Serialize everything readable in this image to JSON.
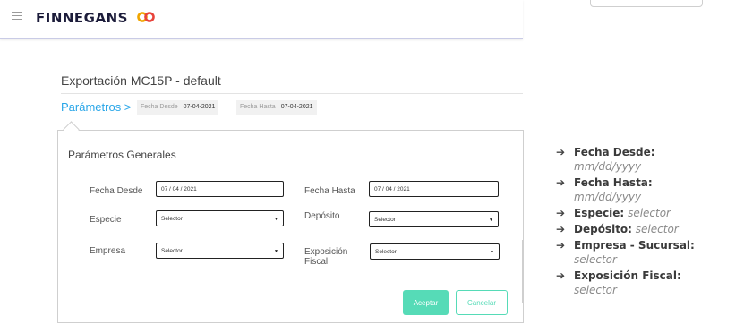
{
  "app": {
    "brand": "FINNEGANS"
  },
  "page": {
    "title": "Exportación MC15P - default",
    "breadcrumb": "Parámetros >",
    "chips": [
      {
        "key": "Fecha Desde",
        "value": "07-04-2021"
      },
      {
        "key": "Fecha Hasta",
        "value": "07-04-2021"
      }
    ]
  },
  "panel": {
    "title": "Parámetros Generales",
    "fields": {
      "fecha_desde": {
        "label": "Fecha Desde",
        "value": "07 / 04 / 2021"
      },
      "fecha_hasta": {
        "label": "Fecha Hasta",
        "value": "07 / 04 / 2021"
      },
      "especie": {
        "label": "Especie",
        "value": "Selector"
      },
      "deposito": {
        "label": "Depósito",
        "value": "Selector"
      },
      "empresa": {
        "label": "Empresa",
        "value": "Selector"
      },
      "exposicion": {
        "label_line1": "Exposición",
        "label_line2": "Fiscal",
        "value": "Selector"
      }
    },
    "buttons": {
      "accept": "Aceptar",
      "cancel": "Cancelar"
    }
  },
  "notes": [
    {
      "label": "Fecha Desde:",
      "detail": "mm/dd/yyyy"
    },
    {
      "label": "Fecha Hasta:",
      "detail": "mm/dd/yyyy"
    },
    {
      "label": "Especie:",
      "detail": "selector"
    },
    {
      "label": "Depósito:",
      "detail": "selector"
    },
    {
      "label": "Empresa - Sucursal:",
      "detail": "selector"
    },
    {
      "label": "Exposición Fiscal:",
      "detail": "selector"
    }
  ],
  "colors": {
    "accent": "#29a6e8",
    "button": "#56dbb7",
    "brand_logo_left": "#f0a500",
    "brand_logo_right": "#e8433b"
  },
  "icons": {
    "menu": "hamburger-icon",
    "dropdown": "caret-down-icon",
    "bullet": "arrow-right-icon"
  }
}
